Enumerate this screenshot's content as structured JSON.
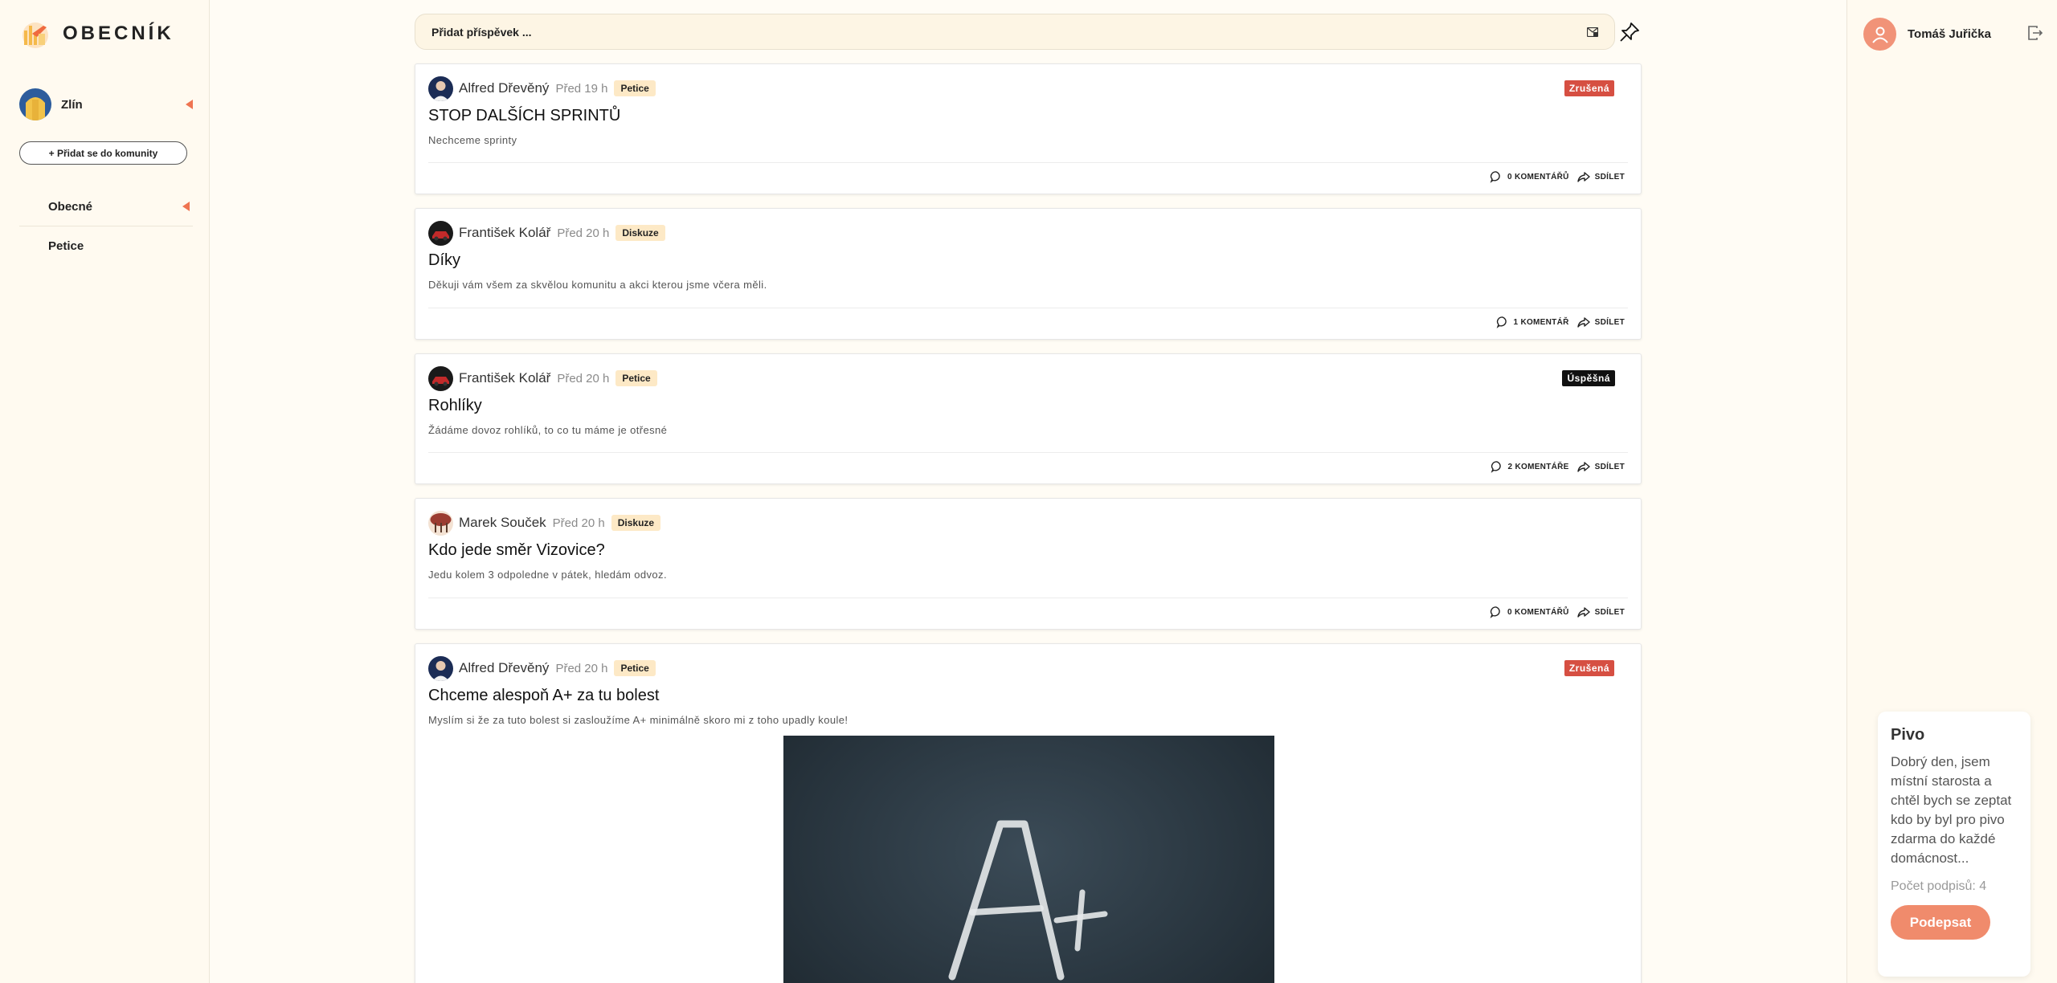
{
  "app": {
    "logo_text": "OBECNÍK"
  },
  "left_sidebar": {
    "community": {
      "name": "Zlín"
    },
    "join_button": "+ Přidat se do komunity",
    "nav": [
      {
        "label": "Obecné"
      },
      {
        "label": "Petice"
      }
    ]
  },
  "composer": {
    "placeholder": "Přidat příspěvek ..."
  },
  "posts": [
    {
      "author": "Alfred Dřevěný",
      "time": "Před 19 h",
      "tag": "Petice",
      "status": "Zrušená",
      "title": "STOP DALŠÍCH SPRINTŮ",
      "body": "Nechceme sprinty",
      "comments": "0 KOMENTÁŘŮ",
      "share": "SDÍLET"
    },
    {
      "author": "František Kolář",
      "time": "Před 20 h",
      "tag": "Diskuze",
      "status": "",
      "title": "Díky",
      "body": "Děkuji vám všem za skvělou komunitu a akci kterou jsme včera měli.",
      "comments": "1 KOMENTÁŘ",
      "share": "SDÍLET"
    },
    {
      "author": "František Kolář",
      "time": "Před 20 h",
      "tag": "Petice",
      "status": "Úspěšná",
      "title": "Rohlíky",
      "body": "Žádáme dovoz rohlíků, to co tu máme je otřesné",
      "comments": "2 KOMENTÁŘE",
      "share": "SDÍLET"
    },
    {
      "author": "Marek Souček",
      "time": "Před 20 h",
      "tag": "Diskuze",
      "status": "",
      "title": "Kdo jede směr Vizovice?",
      "body": "Jedu kolem 3 odpoledne v pátek, hledám odvoz.",
      "comments": "0 KOMENTÁŘŮ",
      "share": "SDÍLET"
    },
    {
      "author": "Alfred Dřevěný",
      "time": "Před 20 h",
      "tag": "Petice",
      "status": "Zrušená",
      "title": "Chceme alespoň A+ za tu bolest",
      "body": "Myslím si že za tuto bolest si zasloužíme A+ minimálně skoro mi z toho upadly koule!",
      "image_text": "A+"
    }
  ],
  "right_sidebar": {
    "user": {
      "name": "Tomáš Juřička"
    },
    "petition_card": {
      "title": "Pivo",
      "text": "Dobrý den, jsem místní starosta a chtěl bych se zeptat kdo by byl pro pivo zdarma do každé domácnost...",
      "count": "Počet podpisů: 4",
      "sign_button": "Podepsat"
    }
  },
  "colors": {
    "accent": "#ef7451",
    "tag_bg": "#fde9c6",
    "status_cancelled": "#d64f42",
    "status_success": "#111111",
    "sign_button": "#f08b6c"
  }
}
